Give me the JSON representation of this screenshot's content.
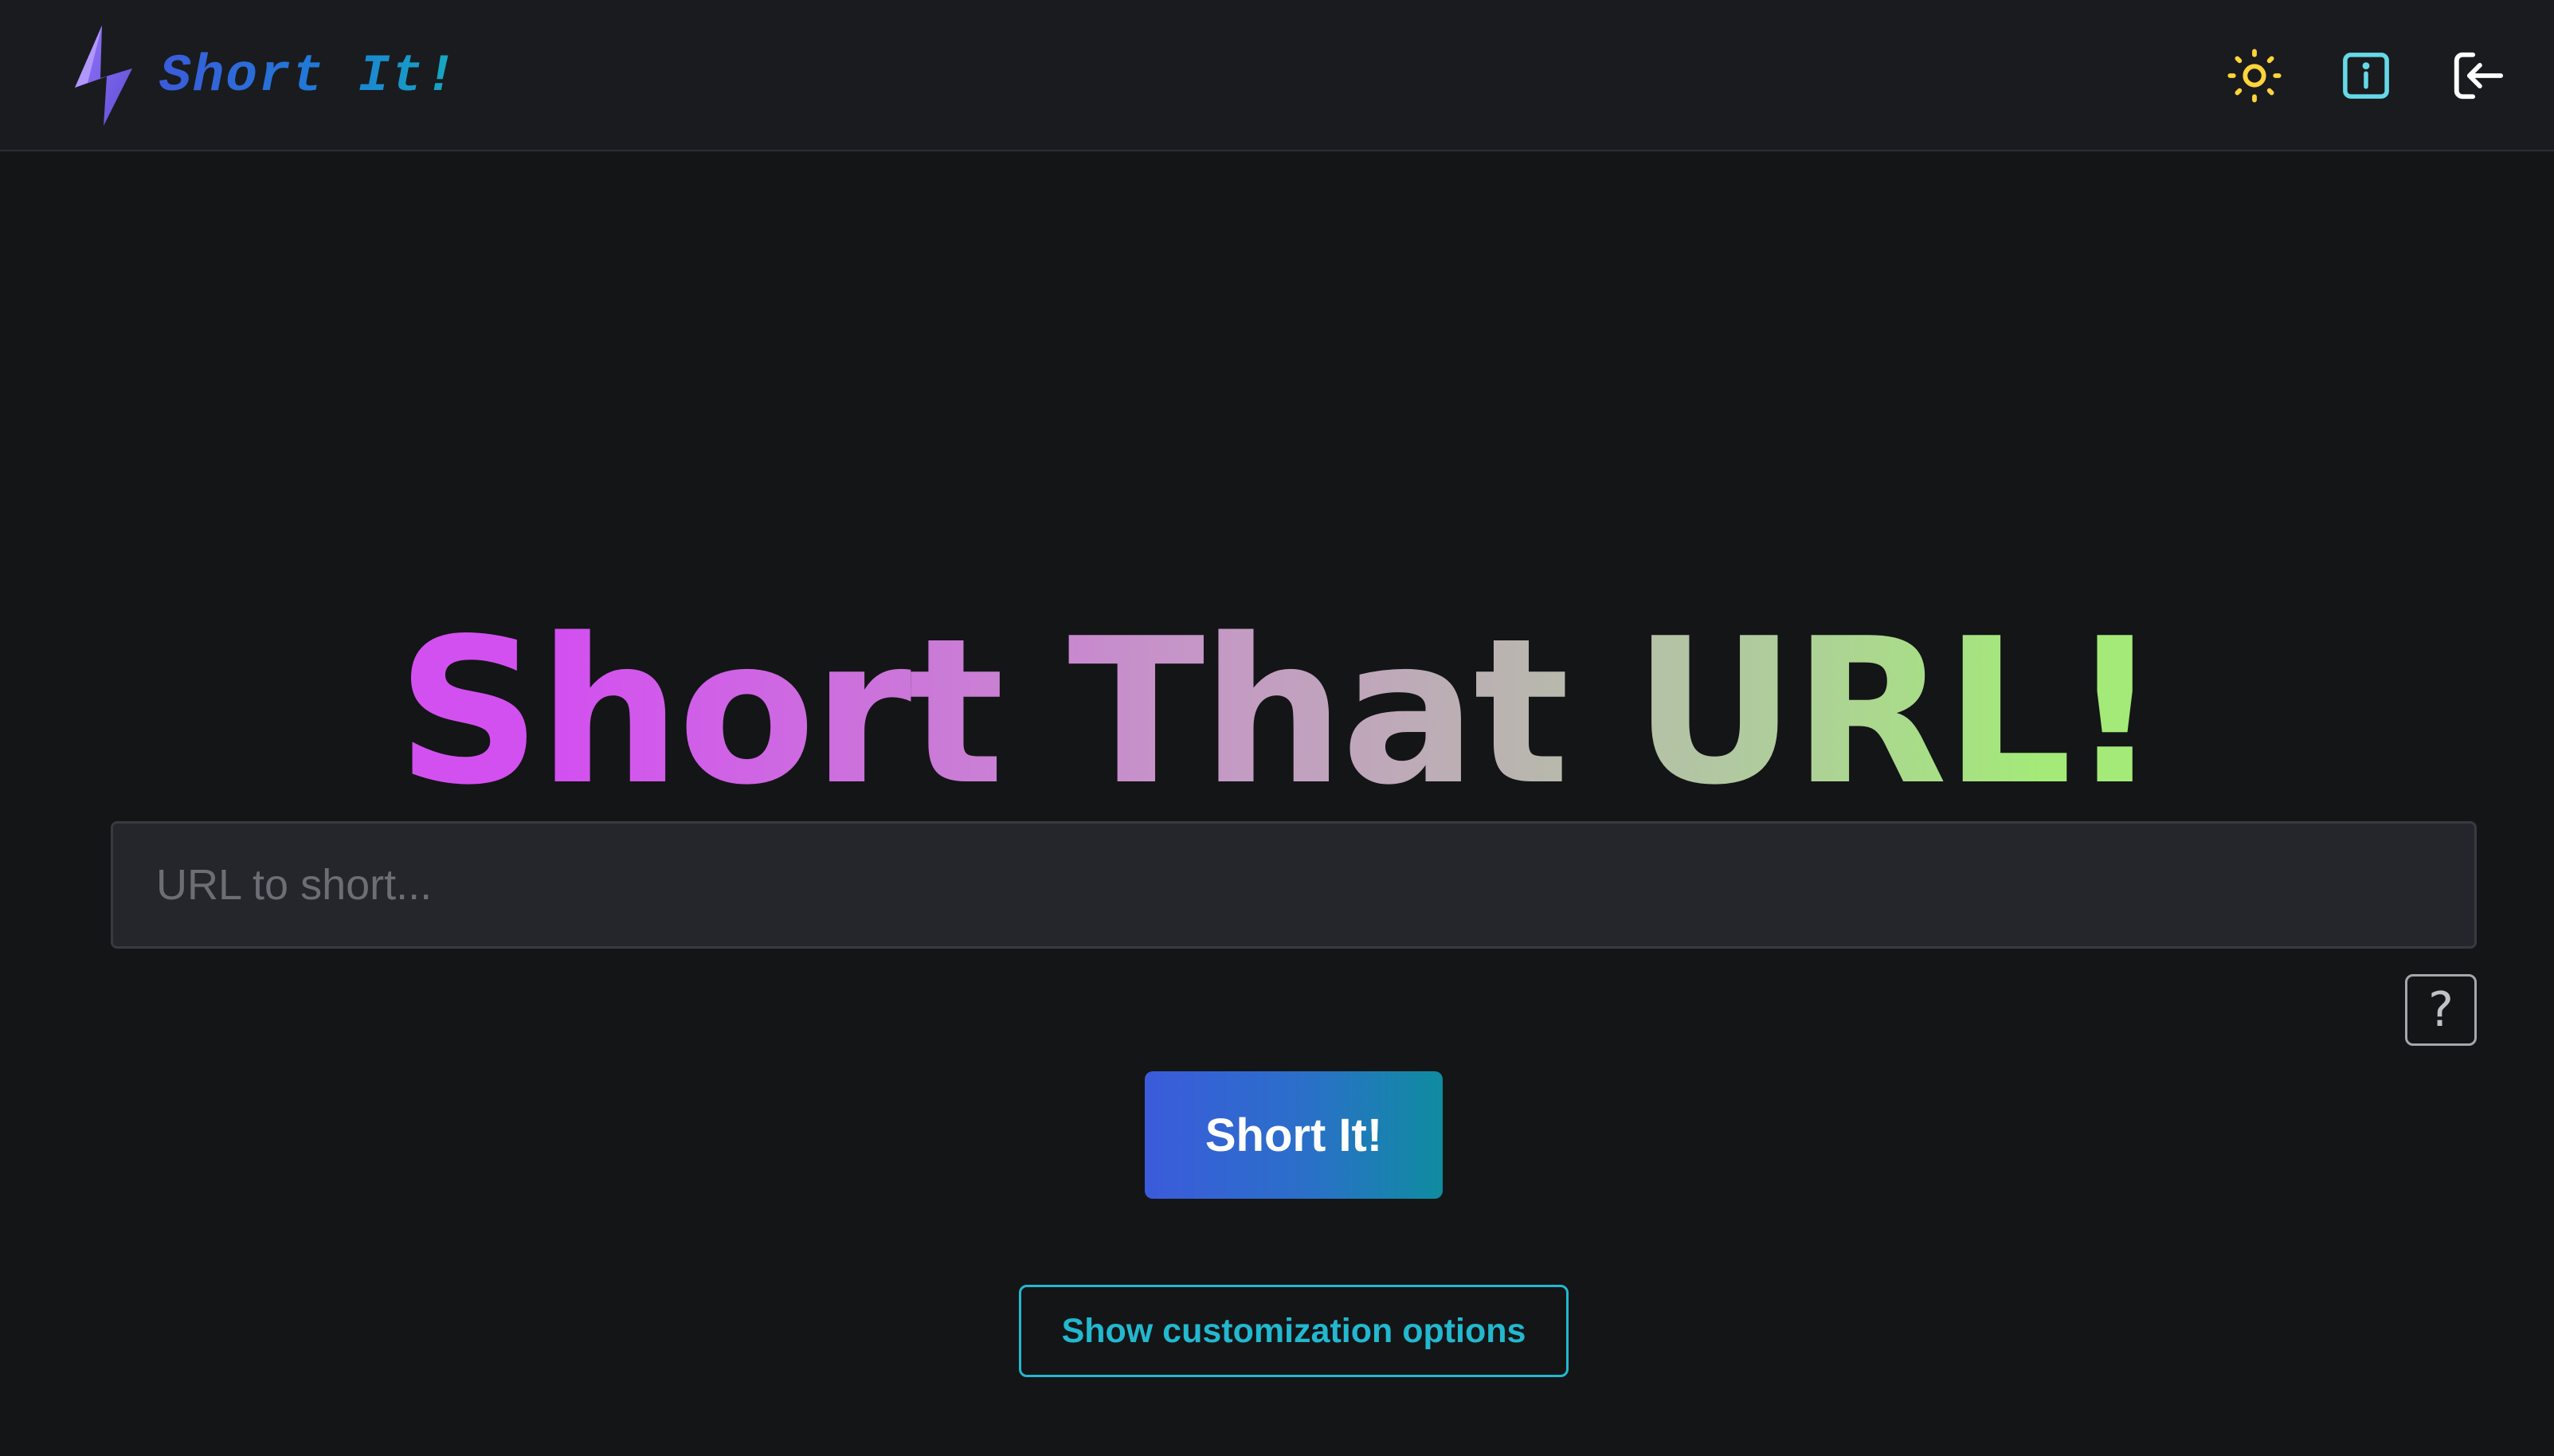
{
  "header": {
    "brand_text": "Short It!",
    "actions": [
      {
        "name": "theme-toggle",
        "icon": "sun-icon",
        "color": "#ffd43b"
      },
      {
        "name": "about",
        "icon": "info-square-icon",
        "color": "#66d9e8"
      },
      {
        "name": "login",
        "icon": "login-icon",
        "color": "#ffffff"
      }
    ]
  },
  "hero": {
    "title": "Short That URL!"
  },
  "form": {
    "url_placeholder": "URL to short...",
    "url_value": "",
    "help_label": "?",
    "submit_label": "Short It!",
    "customize_label": "Show customization options"
  },
  "colors": {
    "background": "#141517",
    "header_bg": "#1a1b1e",
    "accent_cyan": "#22b8cf",
    "accent_blue": "#3b5bdb",
    "title_gradient_start": "#d350f0",
    "title_gradient_end": "#a3ea78"
  }
}
